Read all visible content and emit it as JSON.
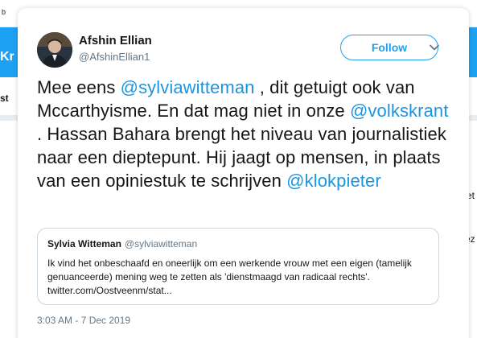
{
  "background": {
    "fragments": [
      "b",
      "Kr",
      "st",
      "et",
      "ez"
    ]
  },
  "tweet": {
    "author": {
      "display_name": "Afshin Ellian",
      "handle": "@AfshinEllian1"
    },
    "follow_label": "Follow",
    "text_segments": [
      {
        "type": "text",
        "value": "Mee eens "
      },
      {
        "type": "mention",
        "value": "@sylviawitteman"
      },
      {
        "type": "text",
        "value": " , dit getuigt ook van Mccarthyisme. En dat mag niet in onze "
      },
      {
        "type": "mention",
        "value": "@volkskrant"
      },
      {
        "type": "text",
        "value": " . Hassan Bahara brengt het niveau van journalistiek naar een dieptepunt. Hij jaagt op mensen, in plaats van een opiniestuk te schrijven "
      },
      {
        "type": "mention",
        "value": "@klokpieter"
      }
    ],
    "quoted": {
      "display_name": "Sylvia Witteman",
      "handle": "@sylviawitteman",
      "text": "Ik vind het onbeschaafd en oneerlijk om een werkende vrouw met een eigen (tamelijk genuanceerde) mening weg te zetten als 'dienstmaagd van radicaal rechts'. twitter.com/Oostveenm/stat..."
    },
    "timestamp": "3:03 AM - 7 Dec 2019"
  },
  "colors": {
    "accent": "#1da1f2",
    "mention": "#1b95e0",
    "text": "#14171a",
    "secondary": "#657786"
  }
}
